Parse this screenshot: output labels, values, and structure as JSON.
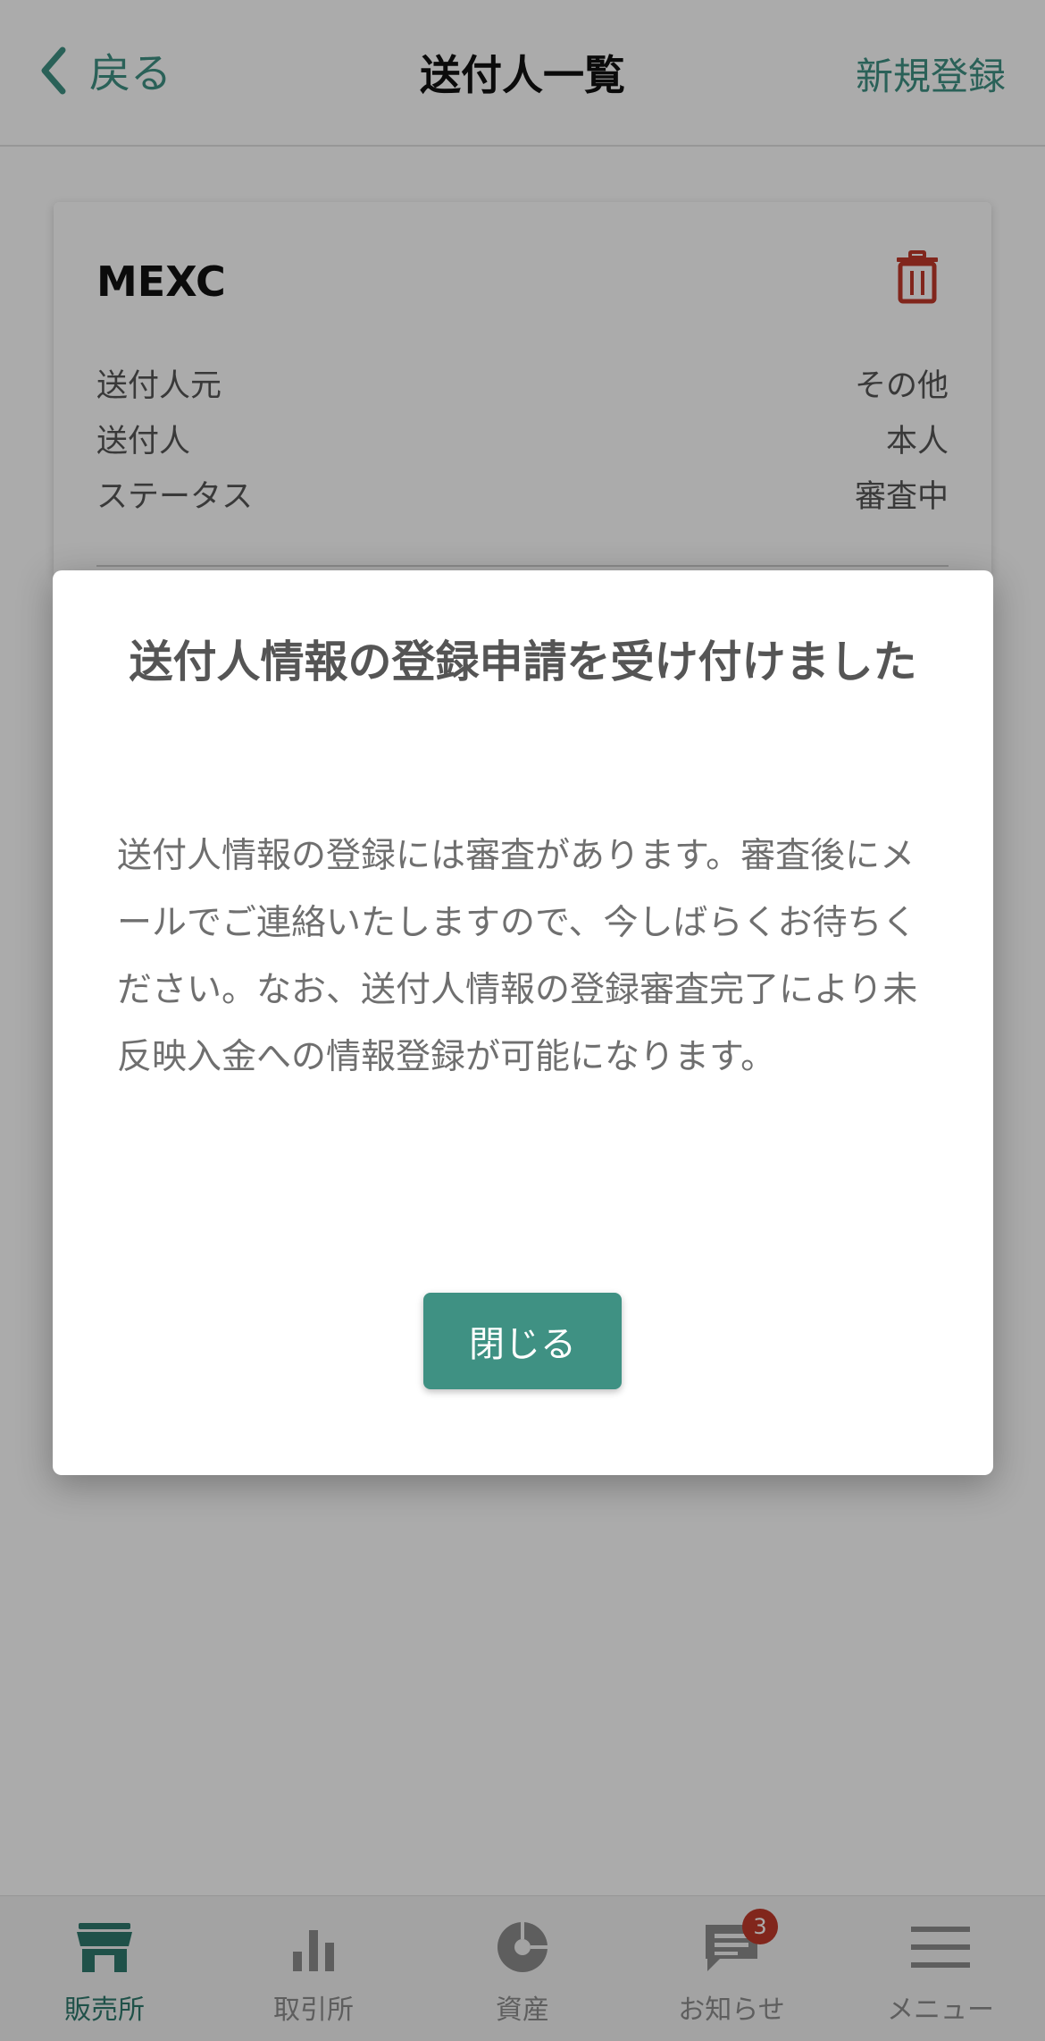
{
  "header": {
    "back_label": "戻る",
    "title": "送付人一覧",
    "action_label": "新規登録"
  },
  "card": {
    "name": "MEXC",
    "rows": [
      {
        "label": "送付人元",
        "value": "その他"
      },
      {
        "label": "送付人",
        "value": "本人"
      },
      {
        "label": "ステータス",
        "value": "審査中"
      }
    ]
  },
  "modal": {
    "title": "送付人情報の登録申請を受け付けました",
    "body": "送付人情報の登録には審査があります。審査後にメールでご連絡いたしますので、今しばらくお待ちください。なお、送付人情報の登録審査完了により未反映入金への情報登録が可能になります。",
    "close_label": "閉じる"
  },
  "bottom_nav": {
    "items": [
      {
        "label": "販売所",
        "icon": "store-icon",
        "active": true
      },
      {
        "label": "取引所",
        "icon": "bar-chart-icon",
        "active": false
      },
      {
        "label": "資産",
        "icon": "pie-chart-icon",
        "active": false
      },
      {
        "label": "お知らせ",
        "icon": "message-icon",
        "active": false,
        "badge": "3"
      },
      {
        "label": "メニュー",
        "icon": "menu-icon",
        "active": false
      }
    ]
  },
  "colors": {
    "accent": "#3f9183",
    "danger": "#c0392b",
    "overlay": "rgba(0,0,0,0.33)"
  }
}
